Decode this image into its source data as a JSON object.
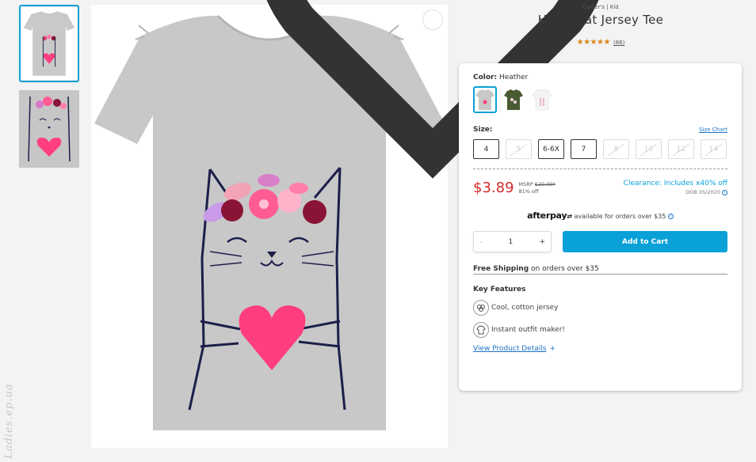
{
  "product": {
    "brand": "Carter's | Kid",
    "title": "Heart Cat Jersey Tee",
    "stars": "★★★★★",
    "review_count": "(66)"
  },
  "color": {
    "label": "Color:",
    "value": "Heather",
    "swatches": [
      "Heather grey",
      "Olive green",
      "White"
    ]
  },
  "size": {
    "label": "Size:",
    "chart_link": "Size Chart",
    "options": [
      {
        "label": "4",
        "available": true
      },
      {
        "label": "5",
        "available": false
      },
      {
        "label": "6-6X",
        "available": true
      },
      {
        "label": "7",
        "available": true
      },
      {
        "label": "8",
        "available": false
      },
      {
        "label": "10",
        "available": false
      },
      {
        "label": "12",
        "available": false
      },
      {
        "label": "14",
        "available": false
      }
    ]
  },
  "pricing": {
    "price": "$3.89",
    "msrp_label": "MSRP",
    "msrp_value": "$20.00*",
    "discount": "81% off",
    "clearance": "Clearance: Includes x40% off",
    "dob": "DOB 05/2020"
  },
  "afterpay": {
    "logo": "afterpay",
    "text": "available for orders over $35"
  },
  "cart": {
    "qty_minus": "-",
    "qty_value": "1",
    "qty_plus": "+",
    "add_label": "Add to Cart"
  },
  "shipping": {
    "bold": "Free Shipping",
    "rest": "on orders over $35"
  },
  "features": {
    "title": "Key Features",
    "items": [
      "Cool, cotton jersey",
      "Instant outfit maker!"
    ],
    "details_link": "View Product Details",
    "details_plus": "+"
  },
  "colors": {
    "accent": "#0aa0d8",
    "price": "#d62a2a",
    "stars": "#d9861a",
    "shirt": "#c8c8c8",
    "heart": "#ff3d7f"
  },
  "watermark": "Ladies.ep.ua"
}
